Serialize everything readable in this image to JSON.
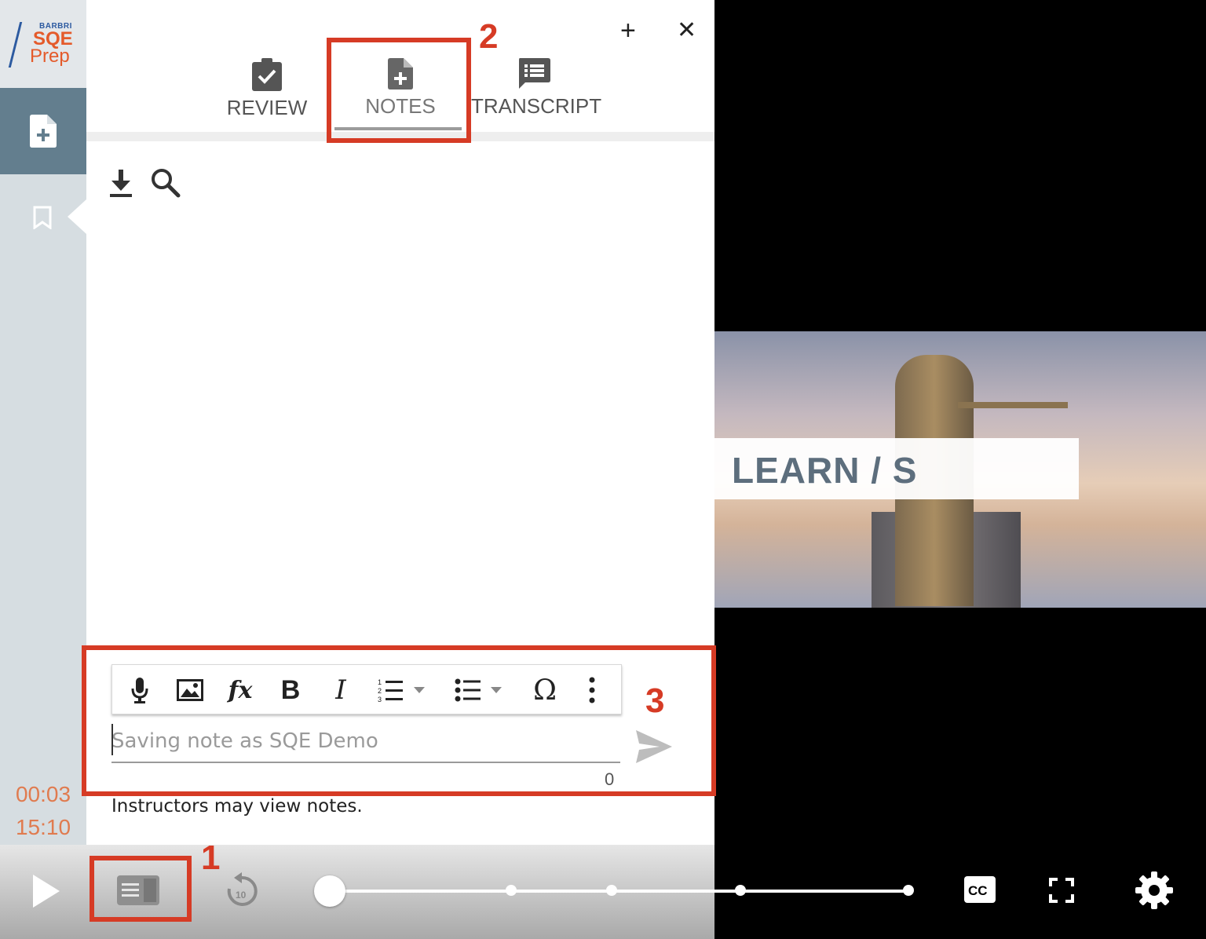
{
  "logo": {
    "line1": "BARBRI",
    "line2": "SQE",
    "line3": "Prep"
  },
  "rail": {
    "current_time": "00:03",
    "total_time": "15:10"
  },
  "panel": {
    "add_label": "+",
    "close_label": "✕",
    "tabs": [
      {
        "label": "REVIEW",
        "icon": "clipboard-check-icon"
      },
      {
        "label": "NOTES",
        "icon": "note-add-icon",
        "active": true
      },
      {
        "label": "TRANSCRIPT",
        "icon": "transcript-icon"
      }
    ]
  },
  "editor": {
    "toolbar": [
      "microphone-icon",
      "image-icon",
      "formula-icon",
      "bold-icon",
      "italic-icon",
      "numbered-list-icon",
      "bulleted-list-icon",
      "special-char-icon",
      "more-icon"
    ],
    "bold_glyph": "B",
    "italic_glyph": "I",
    "omega_glyph": "Ω",
    "fx_glyph": "fx",
    "placeholder": "Saving note as SQE Demo",
    "char_count": "0",
    "notice": "Instructors may view notes."
  },
  "video": {
    "banner_text": "LEARN / S"
  },
  "annotations": {
    "one": "1",
    "two": "2",
    "three": "3"
  },
  "colors": {
    "accent": "#e07b4f",
    "annotation_red": "#d63b25",
    "rail": "#d6dde1",
    "rail_active": "#637e8e"
  }
}
